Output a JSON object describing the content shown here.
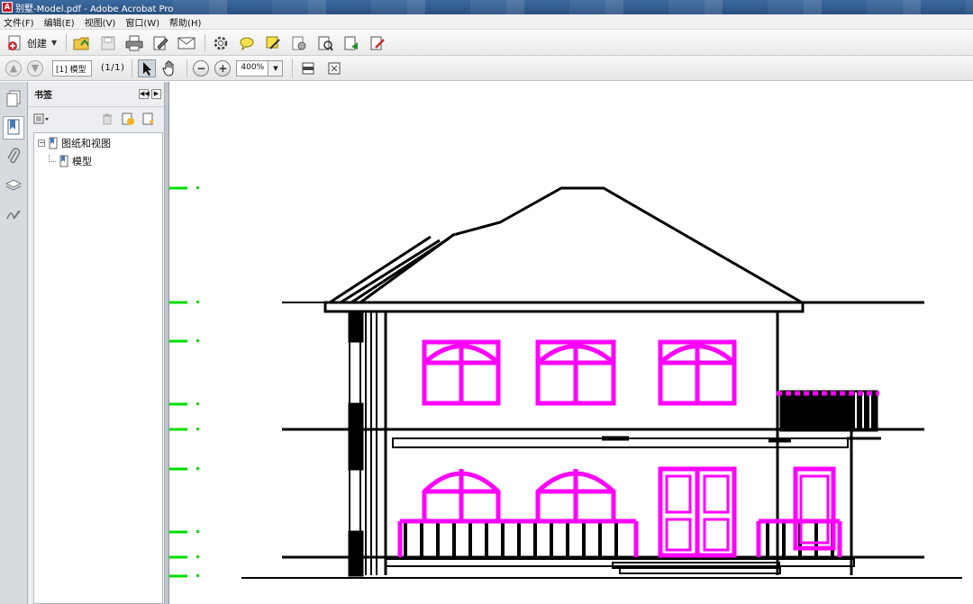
{
  "window": {
    "title": "别墅-Model.pdf - Adobe Acrobat Pro"
  },
  "menu": {
    "items": [
      "文件(F)",
      "编辑(E)",
      "视图(V)",
      "窗口(W)",
      "帮助(H)"
    ]
  },
  "toolbar": {
    "create_label": "创建",
    "icons": [
      "open-icon",
      "save-icon",
      "print-icon",
      "edit-icon",
      "email-icon",
      "settings-icon",
      "comment-icon",
      "sign-icon",
      "secure-icon",
      "export-icon",
      "combine-icon",
      "forms-icon"
    ]
  },
  "navigation": {
    "page_field": "[1] 模型",
    "page_count": "(1/1)",
    "zoom": "400%"
  },
  "panel": {
    "title": "书签",
    "tree": [
      {
        "label": "图纸和视图"
      },
      {
        "label": "模型"
      }
    ]
  },
  "colors": {
    "window_markers": "#ff00ff",
    "level_ticks": "#00dd00",
    "outline": "#000000",
    "titlebar": "#2f5a8c"
  }
}
